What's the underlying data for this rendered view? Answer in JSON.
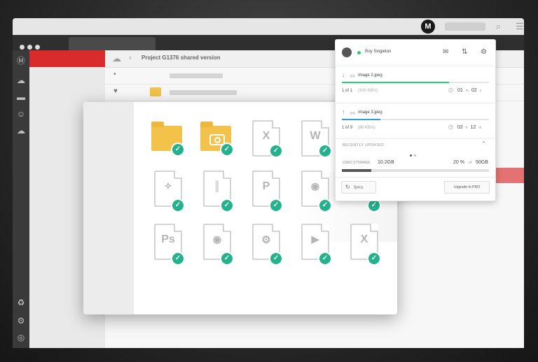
{
  "app": {
    "logo_letter": "M"
  },
  "breadcrumb": {
    "path": "Project G1376 shared version"
  },
  "popup": {
    "user_name": "Roy Singleton",
    "transfers": [
      {
        "direction": "download",
        "file_type": "jpg",
        "file_name": "Image 2.jpeg",
        "count_done": "1",
        "count_total": "1",
        "speed": "(100 KB/s)",
        "time_a": "01",
        "unit_a": "m",
        "time_b": "02",
        "unit_b": "s",
        "progress": 0.73,
        "color": "#2ecc71"
      },
      {
        "direction": "upload",
        "file_type": "jpg",
        "file_name": "Image 3.jpeg",
        "count_done": "1",
        "count_total": "9",
        "speed": "(80 KB/s)",
        "time_a": "02",
        "unit_a": "h",
        "time_b": "12",
        "unit_b": "m",
        "progress": 0.26,
        "color": "#2d9cdb"
      }
    ],
    "recently_updated_label": "RECENTLY UPDATED",
    "storage": {
      "label": "USED STORAGE",
      "used": "10.2GB",
      "percent": "20 %",
      "of": "of",
      "total": "50GB",
      "fraction": 0.2
    },
    "syncs_label": "Syncs",
    "upgrade_label": "Upgrade to PRO"
  },
  "grid_icons": [
    [
      "folder-icon",
      "camera-folder-icon",
      "excel-file-icon",
      "word-file-icon"
    ],
    [
      "image-file-icon",
      "zip-file-icon",
      "powerpoint-file-icon",
      "audio-file-icon",
      "generic-file-icon"
    ],
    [
      "photoshop-file-icon",
      "audio-file-icon",
      "settings-file-icon",
      "video-file-icon",
      "excel-file-icon"
    ]
  ],
  "glyphs": {
    "x": "X",
    "w": "W",
    "p": "P",
    "ps": "Ps"
  },
  "colors": {
    "accent_red": "#d92b2b",
    "check_green": "#24b28c",
    "folder_yellow": "#f3c24b"
  }
}
